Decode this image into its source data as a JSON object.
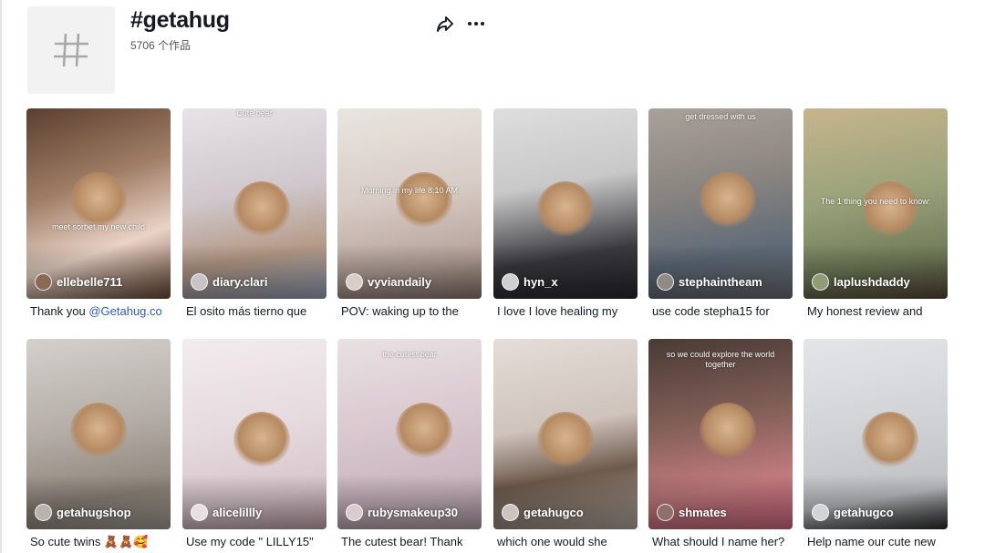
{
  "hashtag": {
    "title": "#getahug",
    "count": "5706 个作品"
  },
  "colors": {
    "accent_mention": "#2b5db9",
    "text": "#161823"
  },
  "videos": [
    {
      "author": "ellebelle711",
      "desc": "Thank you ",
      "mention": "@Getahug.co",
      "overlay_text": "meet sorbet my new child",
      "thumb_color": "#8a6a55"
    },
    {
      "author": "diary.clari",
      "desc": "El osito más tierno que",
      "overlay_text": "Cute bear",
      "thumb_color": "#c9c2c7"
    },
    {
      "author": "vyviandaily",
      "desc": "POV: waking up to the",
      "overlay_text": "Morning in my life 8:10 AM",
      "thumb_color": "#d9cdc8"
    },
    {
      "author": "hyn_x",
      "desc": "I love I love healing my",
      "overlay_text": "",
      "thumb_color": "#cfcfd0"
    },
    {
      "author": "stephaintheam",
      "desc": "use code stepha15 for",
      "overlay_text": "get dressed with us",
      "thumb_color": "#8f8a86"
    },
    {
      "author": "laplushdaddy",
      "desc": "My honest review and",
      "overlay_text": "The 1 thing you need to know:",
      "thumb_color": "#8f9d76"
    },
    {
      "author": "getahugshop",
      "desc": "So cute twins 🧸🧸🥰",
      "overlay_text": "",
      "thumb_color": "#b9b3ae"
    },
    {
      "author": "alicelillly",
      "desc": "Use my code \" LILLY15\"",
      "overlay_text": "",
      "thumb_color": "#e8dfe2"
    },
    {
      "author": "rubysmakeup30",
      "desc": "The cutest bear! Thank",
      "overlay_text": "the cutest bear",
      "thumb_color": "#d9cbd0"
    },
    {
      "author": "getahugco",
      "desc": "which one would she",
      "overlay_text": "",
      "thumb_color": "#cdc4c0"
    },
    {
      "author": "shmates",
      "desc": "What should I name her?",
      "overlay_text": "so we could explore the world together",
      "thumb_color": "#8e6f6a"
    },
    {
      "author": "getahugco",
      "desc": "Help name our cute new",
      "overlay_text": "",
      "thumb_color": "#d2d3d6"
    }
  ]
}
